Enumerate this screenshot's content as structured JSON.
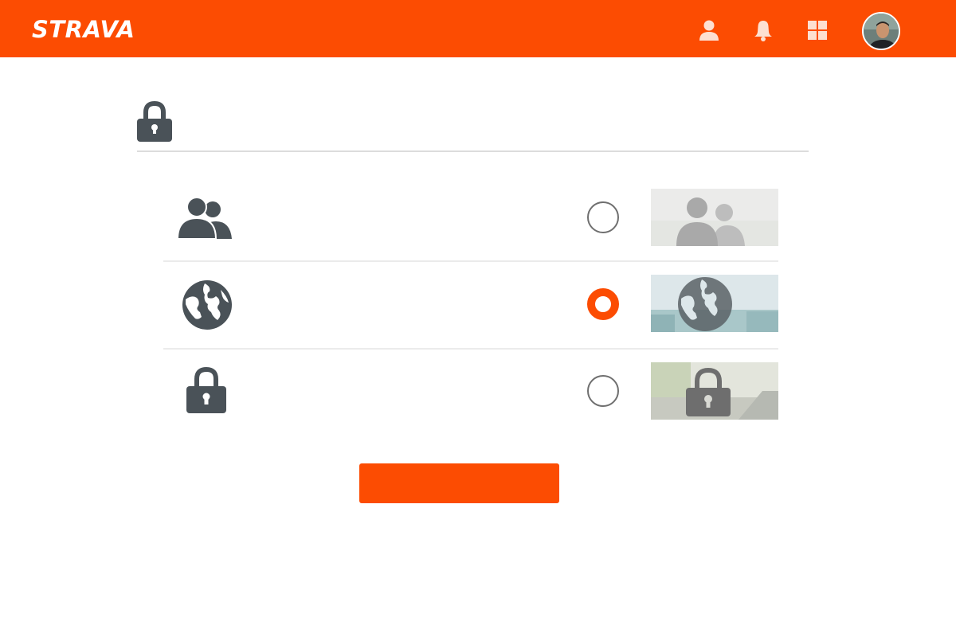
{
  "brand": {
    "name": "STRAVA",
    "color": "#fc4c02"
  },
  "header": {
    "nav_icons": [
      "user-icon",
      "bell-icon",
      "grid-icon"
    ],
    "avatar": "profile-avatar"
  },
  "privacy": {
    "title_icon": "lock-icon",
    "options": [
      {
        "icon": "followers-icon",
        "selected": false,
        "preview": "followers-preview"
      },
      {
        "icon": "globe-icon",
        "selected": true,
        "preview": "everyone-preview"
      },
      {
        "icon": "lock-icon",
        "selected": false,
        "preview": "only-you-preview"
      }
    ]
  },
  "actions": {
    "save_label": ""
  },
  "colors": {
    "accent": "#fc4c02",
    "icon_dark": "#4a5258",
    "divider": "#dcdcdc"
  }
}
